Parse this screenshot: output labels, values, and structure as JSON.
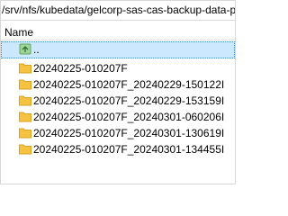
{
  "path": "/srv/nfs/kubedata/gelcorp-sas-cas-backup-data-pvc-",
  "columns": {
    "name": "Name"
  },
  "parent_entry": {
    "label": "..",
    "icon": "parent-directory-icon"
  },
  "folders": [
    {
      "label": "20240225-010207F",
      "icon": "folder-icon"
    },
    {
      "label": "20240225-010207F_20240229-150122I",
      "icon": "folder-icon"
    },
    {
      "label": "20240225-010207F_20240229-153159I",
      "icon": "folder-icon"
    },
    {
      "label": "20240225-010207F_20240301-060206I",
      "icon": "folder-icon"
    },
    {
      "label": "20240225-010207F_20240301-130619I",
      "icon": "folder-icon"
    },
    {
      "label": "20240225-010207F_20240301-134455I",
      "icon": "folder-icon"
    }
  ],
  "colors": {
    "selection": "#cce8ff",
    "folder": "#f5c242"
  }
}
